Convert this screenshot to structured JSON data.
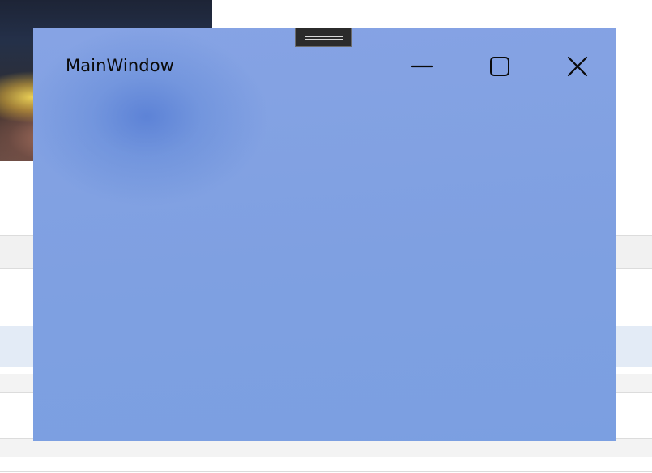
{
  "window": {
    "title": "MainWindow",
    "background_color": "#7fa0e1"
  },
  "caption_buttons": {
    "minimize_icon": "minimize-icon",
    "maximize_icon": "maximize-icon",
    "close_icon": "close-icon"
  }
}
